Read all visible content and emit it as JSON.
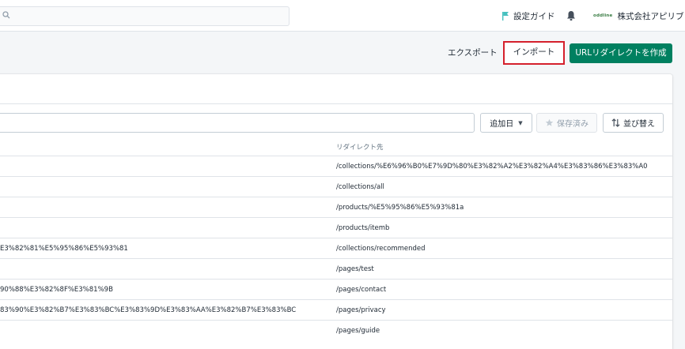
{
  "topbar": {
    "search_icon": "search-icon",
    "guide_label": "設定ガイド",
    "guide_icon": "flag-icon",
    "bell_icon": "bell-icon",
    "store_logo": "oddline",
    "store_name": "株式会社アピリブ"
  },
  "actions": {
    "export_label": "エクスポート",
    "import_label": "インポート",
    "create_label": "URLリダイレクトを作成"
  },
  "filters": {
    "sort_label": "追加日",
    "saved_label": "保存済み",
    "order_label": "並び替え"
  },
  "table": {
    "target_header": "リダイレクト先",
    "rows": [
      {
        "from": "",
        "to": "/collections/%E6%96%B0%E7%9D%80%E3%82%A2%E3%82%A4%E3%83%86%E3%83%A0"
      },
      {
        "from": "",
        "to": "/collections/all"
      },
      {
        "from": "",
        "to": "/products/%E5%95%86%E5%93%81a"
      },
      {
        "from": "",
        "to": "/products/itemb"
      },
      {
        "from": "E3%82%81%E5%95%86%E5%93%81",
        "to": "/collections/recommended"
      },
      {
        "from": "",
        "to": "/pages/test"
      },
      {
        "from": "90%88%E3%82%8F%E3%81%9B",
        "to": "/pages/contact"
      },
      {
        "from": "83%90%E3%82%B7%E3%83%BC%E3%83%9D%E3%83%AA%E3%82%B7%E3%83%BC",
        "to": "/pages/privacy"
      },
      {
        "from": "",
        "to": "/pages/guide"
      }
    ]
  },
  "colors": {
    "primary": "#008060",
    "highlight": "#d5202c",
    "flag": "#47c1bf"
  }
}
